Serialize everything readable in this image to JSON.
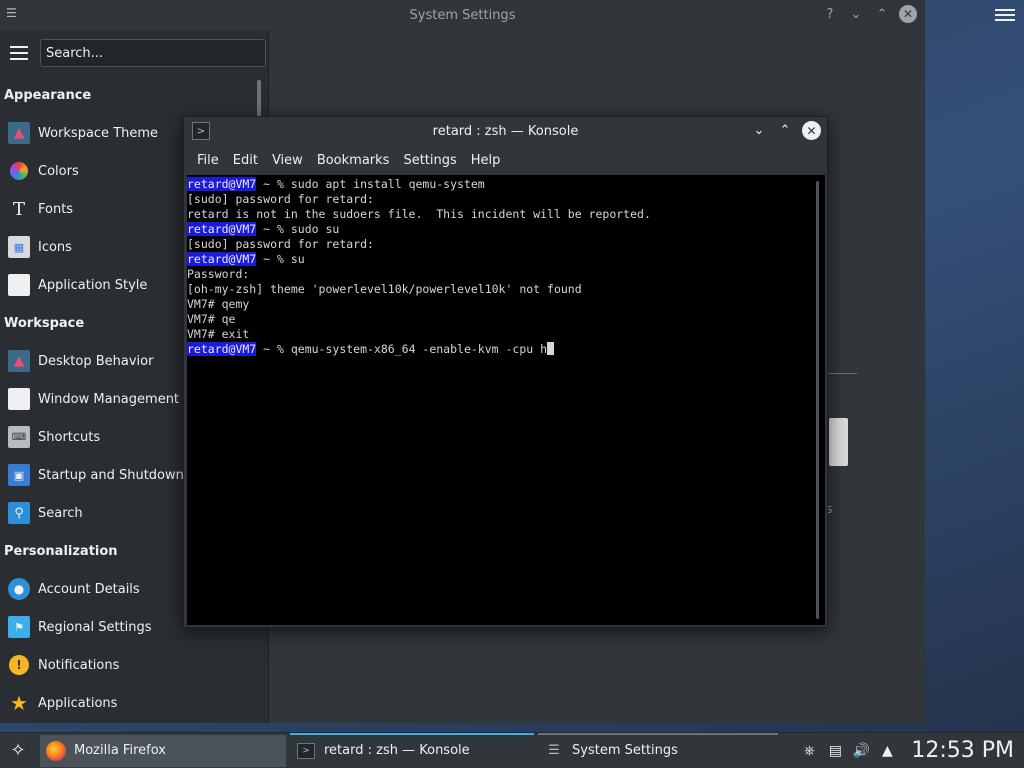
{
  "settings": {
    "title": "System Settings",
    "search_placeholder": "Search...",
    "sections": [
      {
        "header": "Appearance",
        "items": [
          {
            "label": "Workspace Theme",
            "icon": "workspace-theme-icon"
          },
          {
            "label": "Colors",
            "icon": "colors-icon"
          },
          {
            "label": "Fonts",
            "icon": "fonts-icon"
          },
          {
            "label": "Icons",
            "icon": "icons-icon"
          },
          {
            "label": "Application Style",
            "icon": "application-style-icon"
          }
        ]
      },
      {
        "header": "Workspace",
        "items": [
          {
            "label": "Desktop Behavior",
            "icon": "desktop-behavior-icon"
          },
          {
            "label": "Window Management",
            "icon": "window-management-icon"
          },
          {
            "label": "Shortcuts",
            "icon": "keyboard-icon"
          },
          {
            "label": "Startup and Shutdown",
            "icon": "startup-icon"
          },
          {
            "label": "Search",
            "icon": "search-icon"
          }
        ]
      },
      {
        "header": "Personalization",
        "items": [
          {
            "label": "Account Details",
            "icon": "account-icon"
          },
          {
            "label": "Regional Settings",
            "icon": "regional-icon"
          },
          {
            "label": "Notifications",
            "icon": "notifications-icon"
          },
          {
            "label": "Applications",
            "icon": "applications-icon"
          }
        ]
      }
    ],
    "partial_text": "s"
  },
  "konsole": {
    "title": "retard : zsh — Konsole",
    "menu": [
      "File",
      "Edit",
      "View",
      "Bookmarks",
      "Settings",
      "Help"
    ],
    "prompt_user": "retard@VM7",
    "prompt_suffix": " ~ % ",
    "lines": [
      {
        "type": "prompt",
        "text": "sudo apt install qemu-system"
      },
      {
        "type": "out",
        "text": "[sudo] password for retard:"
      },
      {
        "type": "out",
        "text": "retard is not in the sudoers file.  This incident will be reported."
      },
      {
        "type": "prompt",
        "text": "sudo su"
      },
      {
        "type": "out",
        "text": "[sudo] password for retard:"
      },
      {
        "type": "prompt",
        "text": "su"
      },
      {
        "type": "out",
        "text": "Password:"
      },
      {
        "type": "out",
        "text": "[oh-my-zsh] theme 'powerlevel10k/powerlevel10k' not found"
      },
      {
        "type": "out",
        "text": "VM7# qemy"
      },
      {
        "type": "out",
        "text": "VM7# qe"
      },
      {
        "type": "out",
        "text": "VM7# exit"
      },
      {
        "type": "prompt",
        "text": "qemu-system-x86_64 -enable-kvm -cpu h",
        "cursor": true
      }
    ]
  },
  "taskbar": {
    "tasks": [
      {
        "label": "Mozilla Firefox",
        "icon": "firefox-icon"
      },
      {
        "label": "retard : zsh — Konsole",
        "icon": "konsole-icon"
      },
      {
        "label": "System Settings",
        "icon": "settings-icon"
      }
    ],
    "clock": "12:53 PM"
  },
  "colors": {
    "accent": "#3daee9",
    "prompt_bg": "#1c1cd8",
    "window_bg": "#31363b",
    "sidebar_bg": "#2a2e32",
    "terminal_bg": "#000000"
  }
}
